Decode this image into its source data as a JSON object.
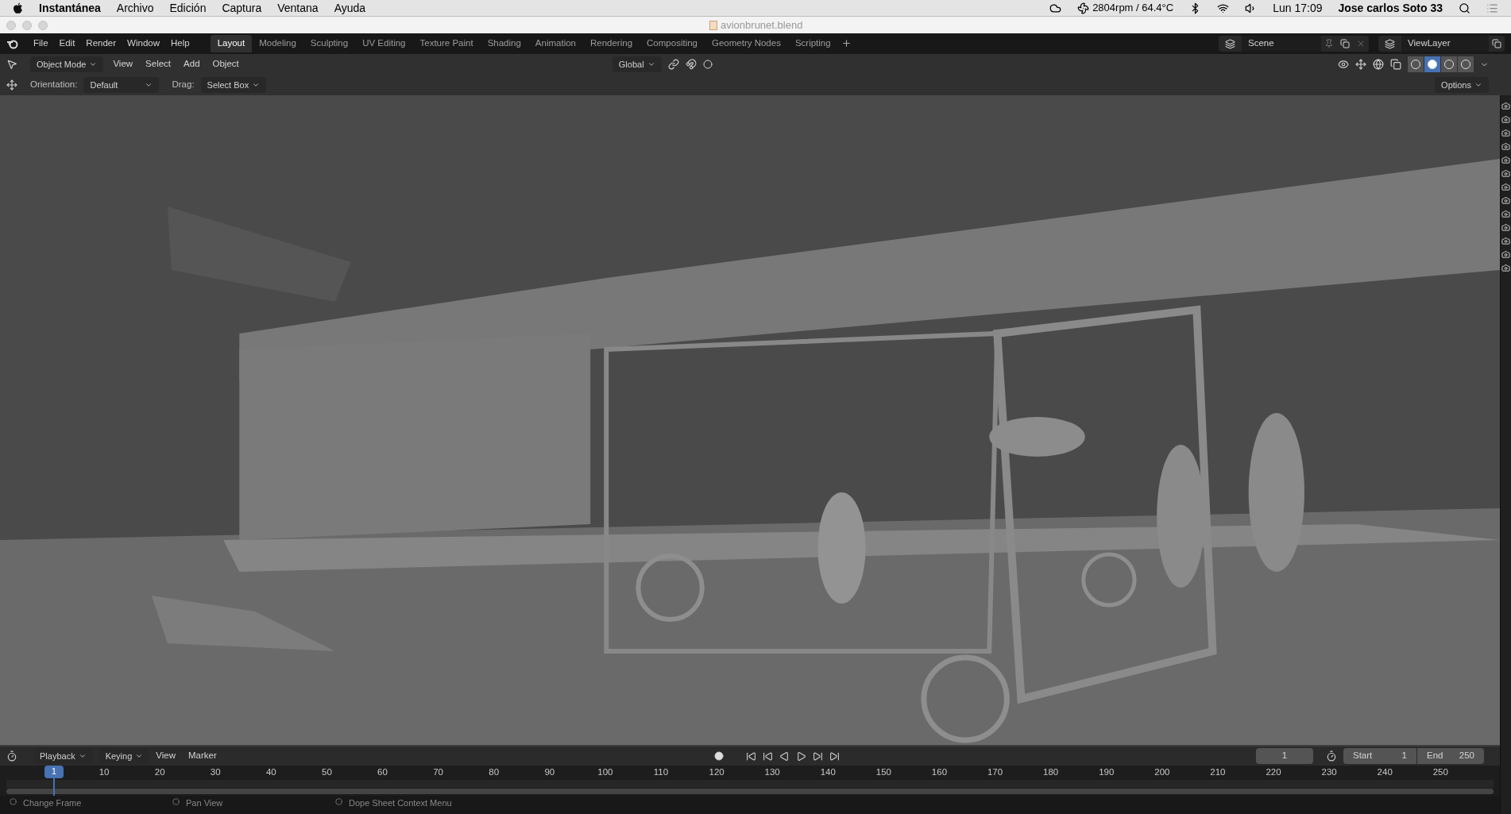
{
  "mac_menubar": {
    "app": "Instantánea",
    "menus": [
      "Archivo",
      "Edición",
      "Captura",
      "Ventana",
      "Ayuda"
    ],
    "fan_status": "2804rpm / 64.4°C",
    "clock": "Lun 17:09",
    "user": "Jose carlos Soto 33"
  },
  "window": {
    "title": "avionbrunet.blend"
  },
  "topbar": {
    "menus": [
      "File",
      "Edit",
      "Render",
      "Window",
      "Help"
    ],
    "workspaces": [
      {
        "label": "Layout",
        "selected": true
      },
      {
        "label": "Modeling",
        "selected": false
      },
      {
        "label": "Sculpting",
        "selected": false
      },
      {
        "label": "UV Editing",
        "selected": false
      },
      {
        "label": "Texture Paint",
        "selected": false
      },
      {
        "label": "Shading",
        "selected": false
      },
      {
        "label": "Animation",
        "selected": false
      },
      {
        "label": "Rendering",
        "selected": false
      },
      {
        "label": "Compositing",
        "selected": false
      },
      {
        "label": "Geometry Nodes",
        "selected": false
      },
      {
        "label": "Scripting",
        "selected": false
      }
    ],
    "scene": "Scene",
    "view_layer": "ViewLayer"
  },
  "viewport_header": {
    "mode": "Object Mode",
    "menus": [
      "View",
      "Select",
      "Add",
      "Object"
    ],
    "transform": "Global",
    "shading_modes": [
      {
        "selected": false
      },
      {
        "selected": true
      },
      {
        "selected": false
      },
      {
        "selected": false
      }
    ]
  },
  "tool_settings": {
    "orientation_label": "Orientation:",
    "orientation": "Default",
    "drag_label": "Drag:",
    "drag": "Select Box",
    "options": "Options"
  },
  "viewport": {
    "kind": "picture"
  },
  "timeline": {
    "menus": [
      "Playback",
      "Keying",
      "View",
      "Marker"
    ],
    "current_frame": "1",
    "start_label": "Start",
    "start": "1",
    "end_label": "End",
    "end": "250",
    "playhead": "1",
    "ticks": [
      "10",
      "20",
      "30",
      "40",
      "50",
      "60",
      "70",
      "80",
      "90",
      "100",
      "110",
      "120",
      "130",
      "140",
      "150",
      "160",
      "170",
      "180",
      "190",
      "200",
      "210",
      "220",
      "230",
      "240",
      "250"
    ]
  },
  "status_bar": [
    "Change Frame",
    "Pan View",
    "Dope Sheet Context Menu"
  ]
}
